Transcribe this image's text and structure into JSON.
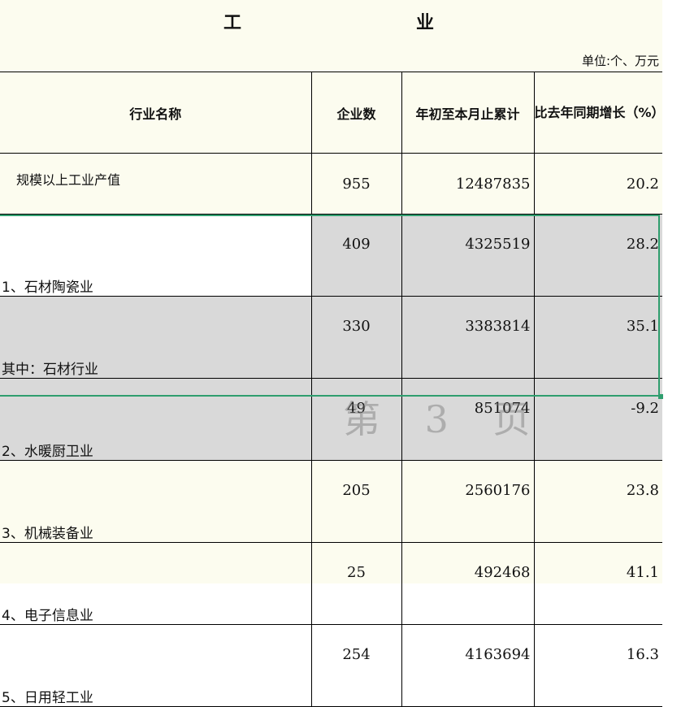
{
  "header": {
    "title_left": "工",
    "title_right": "业",
    "unit": "单位:个、万元"
  },
  "columns": {
    "name": "行业名称",
    "count": "企业数",
    "ytd": "年初至本月止累计",
    "growth": "比去年同期增长（%）"
  },
  "total_row": {
    "name": "规模以上工业产值",
    "count": "955",
    "ytd": "12487835",
    "growth": "20.2"
  },
  "rows": [
    {
      "name": "1、石材陶瓷业",
      "count": "409",
      "ytd": "4325519",
      "growth": "28.2"
    },
    {
      "name": "其中：石材行业",
      "count": "330",
      "ytd": "3383814",
      "growth": "35.1"
    },
    {
      "name": "2、水暖厨卫业",
      "count": "49",
      "ytd": "851074",
      "growth": "-9.2"
    },
    {
      "name": "3、机械装备业",
      "count": "205",
      "ytd": "2560176",
      "growth": "23.8"
    },
    {
      "name": "4、电子信息业",
      "count": "25",
      "ytd": "492468",
      "growth": "41.1"
    },
    {
      "name": "5、日用轻工业",
      "count": "254",
      "ytd": "4163694",
      "growth": "16.3"
    }
  ],
  "watermark": "第 3 页",
  "colors": {
    "selection_border": "#2f9e6e",
    "selection_fill": "#d9d9d9",
    "sheet_background": "#fcfcef"
  }
}
